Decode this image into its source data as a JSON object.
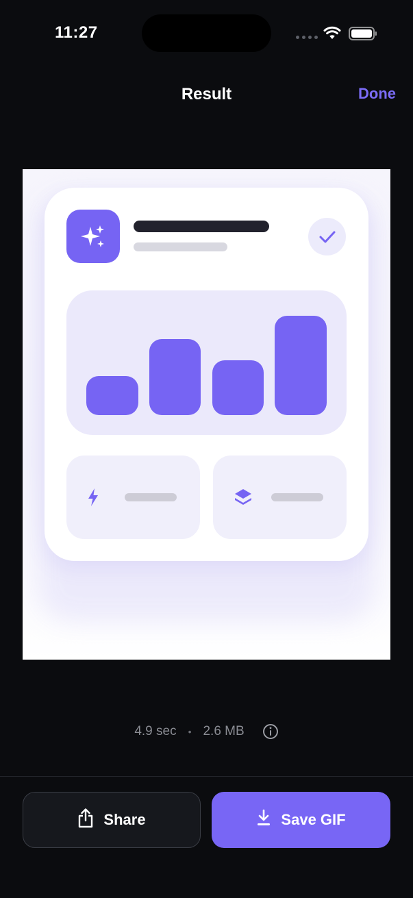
{
  "status_bar": {
    "time": "11:27"
  },
  "nav": {
    "title": "Result",
    "done_label": "Done"
  },
  "meta": {
    "duration": "4.9 sec",
    "separator": "•",
    "size": "2.6 MB"
  },
  "actions": {
    "share_label": "Share",
    "save_label": "Save GIF"
  },
  "colors": {
    "accent": "#7866f5",
    "background": "#0b0c0f"
  },
  "icons": [
    "wifi-icon",
    "battery-icon",
    "info-icon",
    "share-icon",
    "download-icon",
    "sparkle-icon",
    "check-icon",
    "bolt-icon",
    "layers-icon"
  ]
}
